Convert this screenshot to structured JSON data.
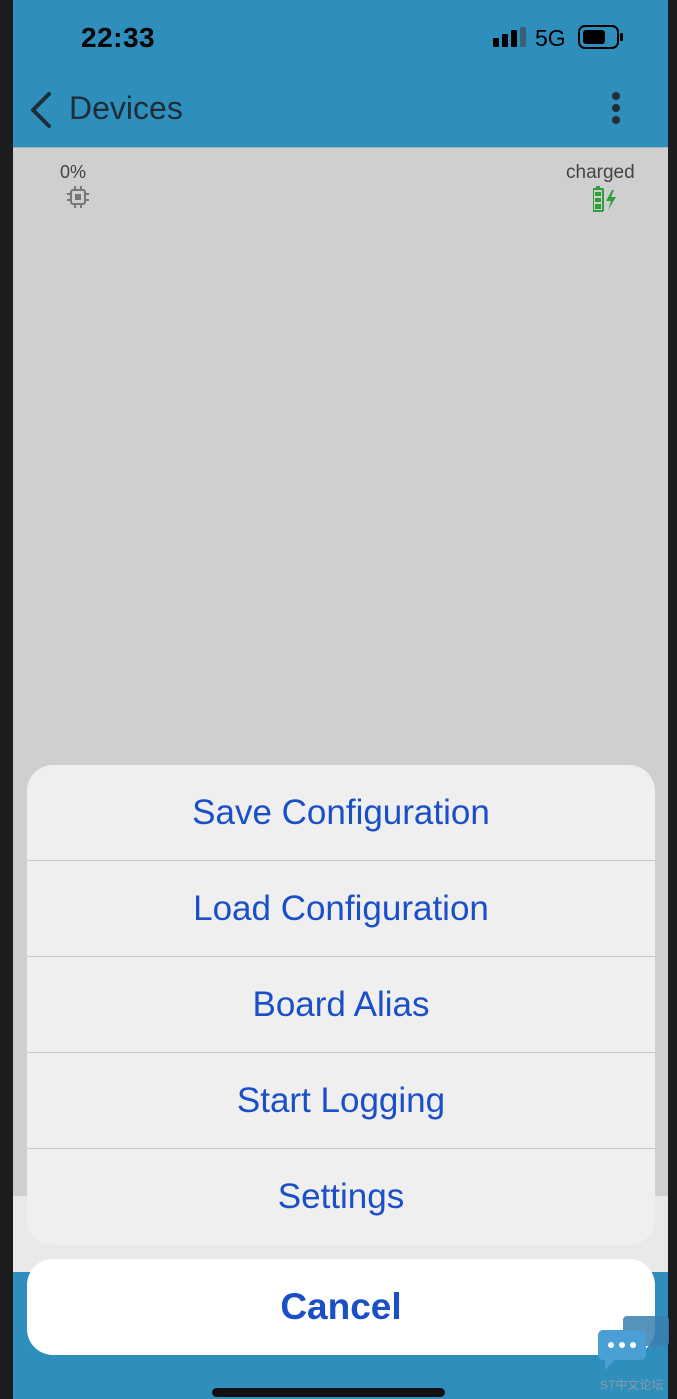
{
  "status_bar": {
    "time": "22:33",
    "network": "5G",
    "signal_icon": "cellular-signal-icon",
    "battery_icon": "battery-icon"
  },
  "nav": {
    "back_icon": "chevron-left-icon",
    "title": "Devices",
    "more_icon": "vertical-ellipsis-icon"
  },
  "device_status": {
    "cpu_label": "0%",
    "cpu_icon": "cpu-chip-icon",
    "battery_label": "charged",
    "battery_icon": "battery-charging-icon"
  },
  "action_sheet": {
    "items": [
      {
        "label": "Save Configuration"
      },
      {
        "label": "Load Configuration"
      },
      {
        "label": "Board Alias"
      },
      {
        "label": "Start Logging"
      },
      {
        "label": "Settings"
      }
    ],
    "cancel_label": "Cancel"
  },
  "overlay": {
    "chat_icon": "chat-bubble-icon",
    "watermark": "ST中文论坛"
  },
  "colors": {
    "header": "#2e8fbd",
    "action_text": "#1a4fc7",
    "background": "#cfcfcf",
    "battery_green": "#2e9e3a"
  }
}
